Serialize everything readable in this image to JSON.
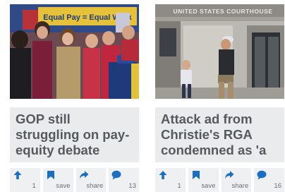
{
  "colors": {
    "accent": "#1a6fc0",
    "headline_bg": "#e9ebec",
    "headline_text": "#555a60"
  },
  "cards": [
    {
      "photo_banner": "Equal Pay = Equal Work",
      "headline": "GOP still struggling on pay-equity debate",
      "actions": [
        {
          "icon": "upvote-arrow-icon",
          "label": "1"
        },
        {
          "icon": "bookmark-icon",
          "label": "save"
        },
        {
          "icon": "share-arrow-icon",
          "label": "share"
        },
        {
          "icon": "comment-bubble-icon",
          "label": "13"
        }
      ]
    },
    {
      "photo_banner": "UNITED STATES COURTHOUSE",
      "headline": "Attack ad from Christie's RGA condemned as 'a",
      "actions": [
        {
          "icon": "upvote-arrow-icon",
          "label": "1"
        },
        {
          "icon": "bookmark-icon",
          "label": "save"
        },
        {
          "icon": "share-arrow-icon",
          "label": "share"
        },
        {
          "icon": "comment-bubble-icon",
          "label": "16"
        }
      ]
    }
  ]
}
